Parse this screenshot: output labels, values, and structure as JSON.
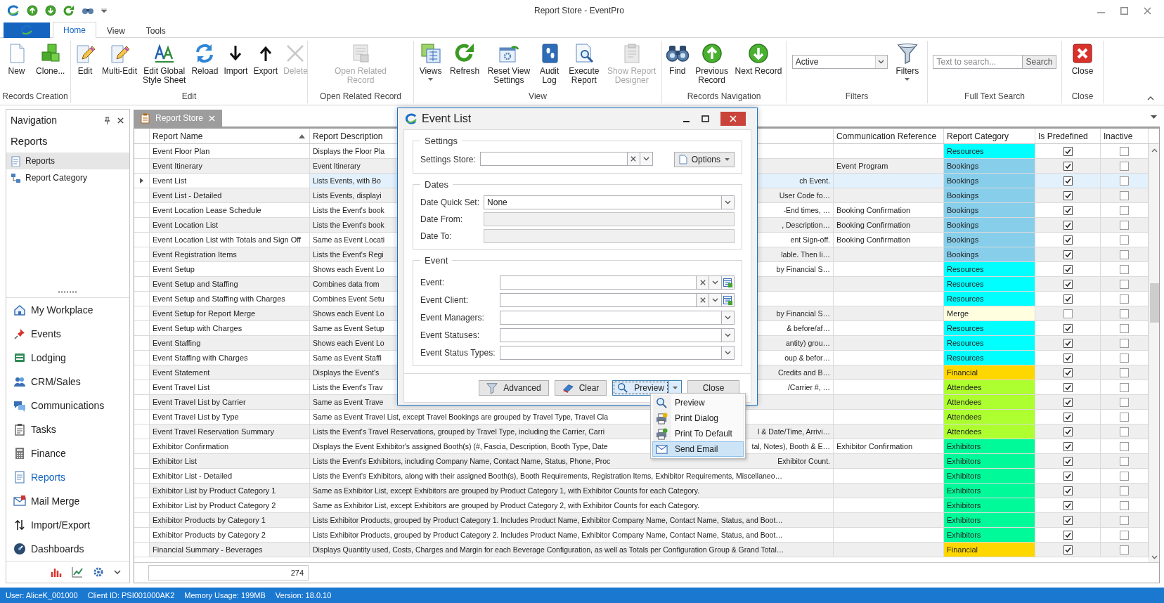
{
  "window": {
    "title": "Report Store - EventPro"
  },
  "ribbon": {
    "tabs": [
      {
        "label": "Home",
        "selected": true
      },
      {
        "label": "View",
        "selected": false
      },
      {
        "label": "Tools",
        "selected": false
      }
    ],
    "groups": [
      {
        "label": "Records Creation",
        "items": [
          {
            "kind": "button",
            "label": "New",
            "disabled": false,
            "dropdown": false
          },
          {
            "kind": "button",
            "label": "Clone...",
            "disabled": false,
            "dropdown": false
          }
        ]
      },
      {
        "label": "Edit",
        "items": [
          {
            "kind": "button",
            "label": "Edit",
            "disabled": false,
            "dropdown": false
          },
          {
            "kind": "button",
            "label": "Multi-Edit",
            "disabled": false,
            "dropdown": false
          },
          {
            "kind": "button",
            "label": "Edit Global\nStyle Sheet",
            "disabled": false,
            "dropdown": false
          },
          {
            "kind": "button",
            "label": "Reload",
            "disabled": false,
            "dropdown": false
          },
          {
            "kind": "button",
            "label": "Import",
            "disabled": false,
            "dropdown": false
          },
          {
            "kind": "button",
            "label": "Export",
            "disabled": false,
            "dropdown": false
          },
          {
            "kind": "button",
            "label": "Delete",
            "disabled": true,
            "dropdown": false
          }
        ]
      },
      {
        "label": "Open Related Record",
        "items": [
          {
            "kind": "button",
            "label": "Open Related\nRecord",
            "disabled": true,
            "dropdown": false
          }
        ]
      },
      {
        "label": "View",
        "items": [
          {
            "kind": "button",
            "label": "Views",
            "disabled": false,
            "dropdown": true
          },
          {
            "kind": "button",
            "label": "Refresh",
            "disabled": false,
            "dropdown": false
          },
          {
            "kind": "button",
            "label": "Reset View\nSettings",
            "disabled": false,
            "dropdown": false
          },
          {
            "kind": "button",
            "label": "Audit\nLog",
            "disabled": false,
            "dropdown": false
          },
          {
            "kind": "button",
            "label": "Execute\nReport",
            "disabled": false,
            "dropdown": false
          },
          {
            "kind": "button",
            "label": "Show Report\nDesigner",
            "disabled": true,
            "dropdown": false
          }
        ]
      },
      {
        "label": "Records Navigation",
        "items": [
          {
            "kind": "button",
            "label": "Find",
            "disabled": false,
            "dropdown": false
          },
          {
            "kind": "button",
            "label": "Previous\nRecord",
            "disabled": false,
            "dropdown": false
          },
          {
            "kind": "button",
            "label": "Next Record",
            "disabled": false,
            "dropdown": false
          }
        ]
      },
      {
        "label": "Filters",
        "items": [
          {
            "kind": "combo",
            "value": "Active"
          },
          {
            "kind": "button",
            "label": "Filters",
            "disabled": false,
            "dropdown": true
          }
        ]
      },
      {
        "label": "Full Text Search",
        "items": [
          {
            "kind": "search",
            "placeholder": "Text to search...",
            "button": "Search"
          }
        ]
      },
      {
        "label": "Close",
        "items": [
          {
            "kind": "button",
            "label": "Close",
            "disabled": false,
            "dropdown": false
          }
        ]
      }
    ]
  },
  "navigation": {
    "title": "Navigation",
    "section_title": "Reports",
    "section_items": [
      {
        "label": "Reports",
        "selected": true
      },
      {
        "label": "Report Category",
        "selected": false
      }
    ],
    "modules": [
      {
        "label": "My Workplace",
        "selected": false
      },
      {
        "label": "Events",
        "selected": false
      },
      {
        "label": "Lodging",
        "selected": false
      },
      {
        "label": "CRM/Sales",
        "selected": false
      },
      {
        "label": "Communications",
        "selected": false
      },
      {
        "label": "Tasks",
        "selected": false
      },
      {
        "label": "Finance",
        "selected": false
      },
      {
        "label": "Reports",
        "selected": true
      },
      {
        "label": "Mail Merge",
        "selected": false
      },
      {
        "label": "Import/Export",
        "selected": false
      },
      {
        "label": "Dashboards",
        "selected": false
      }
    ]
  },
  "document_tabs": [
    {
      "label": "Report Store",
      "selected": true
    }
  ],
  "table": {
    "columns": [
      {
        "label": "Report Name",
        "sorted": true
      },
      {
        "label": "Report Description",
        "sorted": false
      },
      {
        "label": "Communication Reference",
        "sorted": false
      },
      {
        "label": "Report Category",
        "sorted": false
      },
      {
        "label": "Is Predefined",
        "sorted": false
      },
      {
        "label": "Inactive",
        "sorted": false
      }
    ],
    "rows": [
      {
        "name": "Event Floor Plan",
        "description": "Displays the Floor Pla",
        "category": "Resources",
        "color": "#00ffff",
        "predefined": true,
        "inactive": false,
        "selected": false
      },
      {
        "name": "Event Itinerary",
        "description": "Event Itinerary",
        "communication_reference": "Event Program",
        "category": "Bookings",
        "color": "#87ceeb",
        "predefined": true,
        "inactive": false,
        "selected": false
      },
      {
        "name": "Event List",
        "description": "Lists Events, with Bo",
        "description_end": "ch Event.",
        "category": "Bookings",
        "color": "#87ceeb",
        "predefined": true,
        "inactive": false,
        "selected": true
      },
      {
        "name": "Event List - Detailed",
        "description": "Lists Events, displayi",
        "description_end": "User Code fo…",
        "category": "Bookings",
        "color": "#87ceeb",
        "predefined": true,
        "inactive": false,
        "selected": false
      },
      {
        "name": "Event Location Lease Schedule",
        "description": "Lists the Event's book",
        "description_end": "-End times, …",
        "communication_reference": "Booking Confirmation",
        "category": "Bookings",
        "color": "#87ceeb",
        "predefined": true,
        "inactive": false,
        "selected": false
      },
      {
        "name": "Event Location List",
        "description": "Lists the Event's book",
        "description_end": ", Description…",
        "communication_reference": "Booking Confirmation",
        "category": "Bookings",
        "color": "#87ceeb",
        "predefined": true,
        "inactive": false,
        "selected": false
      },
      {
        "name": "Event Location List with Totals and Sign Off",
        "description": "Same as Event Locati",
        "description_end": "ent Sign-off.",
        "communication_reference": "Booking Confirmation",
        "category": "Bookings",
        "color": "#87ceeb",
        "predefined": true,
        "inactive": false,
        "selected": false
      },
      {
        "name": "Event Registration Items",
        "description": "Lists the Event's Regi",
        "description_end": "lable. Then li…",
        "category": "Bookings",
        "color": "#87ceeb",
        "predefined": true,
        "inactive": false,
        "selected": false
      },
      {
        "name": "Event Setup",
        "description": "Shows each Event Lo",
        "description_end": "by Financial S…",
        "category": "Resources",
        "color": "#00ffff",
        "predefined": true,
        "inactive": false,
        "selected": false
      },
      {
        "name": "Event Setup and Staffing",
        "description": "Combines data from",
        "category": "Resources",
        "color": "#00ffff",
        "predefined": true,
        "inactive": false,
        "selected": false
      },
      {
        "name": "Event Setup and Staffing with Charges",
        "description": "Combines Event Setu",
        "category": "Resources",
        "color": "#00ffff",
        "predefined": true,
        "inactive": false,
        "selected": false
      },
      {
        "name": "Event Setup for Report Merge",
        "description": "Shows each Event Lo",
        "description_end": "by Financial S…",
        "category": "Merge",
        "color": "#ffffe0",
        "predefined": false,
        "inactive": false,
        "selected": false
      },
      {
        "name": "Event Setup with Charges",
        "description": "Same as Event Setup",
        "description_end": "& before/af…",
        "category": "Resources",
        "color": "#00ffff",
        "predefined": true,
        "inactive": false,
        "selected": false
      },
      {
        "name": "Event Staffing",
        "description": "Shows each Event Lo",
        "description_end": "antity) grou…",
        "category": "Resources",
        "color": "#00ffff",
        "predefined": true,
        "inactive": false,
        "selected": false
      },
      {
        "name": "Event Staffing with Charges",
        "description": "Same as Event Staffi",
        "description_end": "oup & befor…",
        "category": "Resources",
        "color": "#00ffff",
        "predefined": true,
        "inactive": false,
        "selected": false
      },
      {
        "name": "Event Statement",
        "description": "Displays the Event's",
        "description_end": "Credits and B…",
        "category": "Financial",
        "color": "#ffd700",
        "predefined": true,
        "inactive": false,
        "selected": false
      },
      {
        "name": "Event Travel List",
        "description": "Lists the Event's Trav",
        "description_end": "/Carrier #, …",
        "category": "Attendees",
        "color": "#adff2f",
        "predefined": true,
        "inactive": false,
        "selected": false
      },
      {
        "name": "Event Travel List by Carrier",
        "description": "Same as Event Trave",
        "category": "Attendees",
        "color": "#adff2f",
        "predefined": true,
        "inactive": false,
        "selected": false
      },
      {
        "name": "Event Travel List by Type",
        "description": "Same as Event Travel List, except Travel Bookings are grouped by Travel Type, Travel Cla",
        "category": "Attendees",
        "color": "#adff2f",
        "predefined": true,
        "inactive": false,
        "selected": false
      },
      {
        "name": "Event Travel Reservation Summary",
        "description": "Lists the Event's Travel Reservations, grouped by Travel Type, including the Carrier, Carri",
        "description_end": "l & Date/Time, Arrivi…",
        "category": "Attendees",
        "color": "#adff2f",
        "predefined": true,
        "inactive": false,
        "selected": false
      },
      {
        "name": "Exhibitor Confirmation",
        "description": "Displays the Event Exhibitor's assigned Booth(s) (#, Fascia, Description, Booth Type, Date",
        "description_end": "tal, Notes), Booth & E…",
        "communication_reference": "Exhibitor Confirmation",
        "category": "Exhibitors",
        "color": "#00fa9a",
        "predefined": true,
        "inactive": false,
        "selected": false
      },
      {
        "name": "Exhibitor List",
        "description": "Lists the Event's Exhibitors, including Company Name, Contact Name, Status, Phone, Proc",
        "description_end": "Exhibitor Count.",
        "category": "Exhibitors",
        "color": "#00fa9a",
        "predefined": true,
        "inactive": false,
        "selected": false
      },
      {
        "name": "Exhibitor List - Detailed",
        "description": "Lists the Event’s Exhibitors, along with their assigned Booth(s), Booth Requirements, Registration Items, Exhibitor Requirements, Miscellaneo…",
        "category": "Exhibitors",
        "color": "#00fa9a",
        "predefined": true,
        "inactive": false,
        "selected": false
      },
      {
        "name": "Exhibitor List by Product Category 1",
        "description": "Same as Exhibitor List, except Exhibitors are grouped by Product Category 1, with Exhibitor Counts for each Category.",
        "category": "Exhibitors",
        "color": "#00fa9a",
        "predefined": true,
        "inactive": false,
        "selected": false
      },
      {
        "name": "Exhibitor List by Product Category 2",
        "description": "Same as Exhibitor List, except Exhibitors are grouped by Product Category 2, with Exhibitor Counts for each Category.",
        "category": "Exhibitors",
        "color": "#00fa9a",
        "predefined": true,
        "inactive": false,
        "selected": false
      },
      {
        "name": "Exhibitor Products by Category 1",
        "description": "Lists Exhibitor Products, grouped by Product Category 1. Includes Product Name, Exhibitor Company Name, Contact Name, Status, and Boot…",
        "category": "Exhibitors",
        "color": "#00fa9a",
        "predefined": true,
        "inactive": false,
        "selected": false
      },
      {
        "name": "Exhibitor Products by Category 2",
        "description": "Lists Exhibitor Products, grouped by Product Category 2. Includes Product Name, Exhibitor Company Name, Contact Name, Status, and Boot…",
        "category": "Exhibitors",
        "color": "#00fa9a",
        "predefined": true,
        "inactive": false,
        "selected": false
      },
      {
        "name": "Financial Summary - Beverages",
        "description": "Displays Quantity used, Costs, Charges and Margin for each Beverage Configuration, as well as Totals per Configuration Group & Grand Total…",
        "category": "Financial",
        "color": "#ffd700",
        "predefined": true,
        "inactive": false,
        "selected": false
      }
    ],
    "row_count": "274"
  },
  "dialog": {
    "title": "Event List",
    "groups": [
      {
        "title": "Settings",
        "fields": [
          {
            "label": "Settings Store:",
            "clearable": true,
            "dropdown": true,
            "lookup": false,
            "disabled": false
          }
        ],
        "button": "Options"
      },
      {
        "title": "Dates",
        "fields": [
          {
            "label": "Date Quick Set:",
            "value": "None",
            "clearable": false,
            "dropdown": true,
            "lookup": false,
            "disabled": false
          },
          {
            "label": "Date From:",
            "clearable": false,
            "dropdown": false,
            "lookup": false,
            "disabled": true
          },
          {
            "label": "Date To:",
            "clearable": false,
            "dropdown": false,
            "lookup": false,
            "disabled": true
          }
        ]
      },
      {
        "title": "Event",
        "fields": [
          {
            "label": "Event:",
            "clearable": true,
            "dropdown": true,
            "lookup": true,
            "disabled": false
          },
          {
            "label": "Event Client:",
            "clearable": true,
            "dropdown": true,
            "lookup": true,
            "disabled": false
          },
          {
            "label": "Event Managers:",
            "clearable": false,
            "dropdown": true,
            "lookup": false,
            "disabled": false
          },
          {
            "label": "Event Statuses:",
            "clearable": false,
            "dropdown": true,
            "lookup": false,
            "disabled": false
          },
          {
            "label": "Event Status Types:",
            "clearable": false,
            "dropdown": true,
            "lookup": false,
            "disabled": false
          }
        ]
      }
    ],
    "buttons": [
      {
        "label": "Advanced",
        "kind": "button",
        "focused": false
      },
      {
        "label": "Clear",
        "kind": "button",
        "focused": false
      },
      {
        "label": "Preview",
        "kind": "split",
        "focused": true
      },
      {
        "label": "Close",
        "kind": "button",
        "focused": false
      }
    ],
    "menu": [
      {
        "label": "Preview",
        "selected": false
      },
      {
        "label": "Print Dialog",
        "selected": false
      },
      {
        "label": "Print To Default",
        "selected": false
      },
      {
        "label": "Send Email",
        "selected": true
      }
    ]
  },
  "status_bar": [
    "User: AliceK_001000",
    "Client ID: PSI001000AK2",
    "Memory Usage: 199MB",
    "Version: 18.0.10"
  ]
}
